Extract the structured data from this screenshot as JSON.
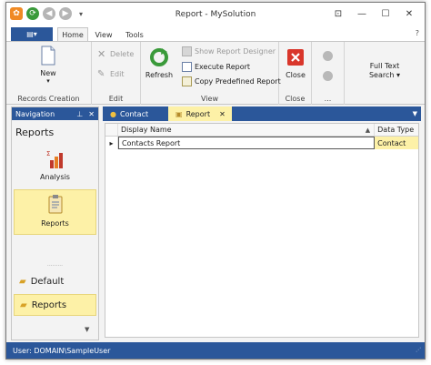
{
  "window": {
    "title": "Report - MySolution",
    "controls": {
      "help": "⊡",
      "minimize": "—",
      "maximize": "☐",
      "close": "✕"
    }
  },
  "qat": {
    "dropdown": "▾"
  },
  "ribbon_tabs": {
    "file_glyph": "▤▾",
    "tabs": [
      {
        "label": "Home",
        "active": true
      },
      {
        "label": "View",
        "active": false
      },
      {
        "label": "Tools",
        "active": false
      }
    ],
    "help": "?"
  },
  "ribbon": {
    "groups": {
      "records_creation": {
        "label": "Records Creation",
        "new": "New",
        "new_arrow": "▾"
      },
      "edit": {
        "label": "Edit",
        "delete": "Delete",
        "edit": "Edit"
      },
      "view": {
        "label": "View",
        "refresh": "Refresh",
        "show_report_designer": "Show Report Designer",
        "execute_report": "Execute Report",
        "copy_predefined_report": "Copy Predefined Report"
      },
      "close": {
        "label": "Close",
        "close": "Close"
      },
      "more": {
        "label": "..."
      },
      "search": {
        "line1": "Full Text",
        "line2": "Search ▾"
      }
    }
  },
  "navigation": {
    "header": "Navigation",
    "pin": "⊥",
    "close": "✕",
    "section_title": "Reports",
    "items": [
      {
        "label": "Analysis",
        "selected": false
      },
      {
        "label": "Reports",
        "selected": true
      }
    ],
    "splitter": "·········",
    "groups": [
      {
        "label": "Default",
        "selected": false
      },
      {
        "label": "Reports",
        "selected": true
      }
    ],
    "dropdown": "▼"
  },
  "doc_tabs": {
    "tabs": [
      {
        "label": "Contact",
        "active": false
      },
      {
        "label": "Report",
        "active": true,
        "close": "✕"
      }
    ],
    "menu": "▼"
  },
  "grid": {
    "columns": [
      "Display Name",
      "Data Type"
    ],
    "sort_indicator": "▲",
    "rows": [
      {
        "indicator": "▸",
        "display_name": "Contacts Report",
        "data_type": "Contact"
      }
    ]
  },
  "status": {
    "text": "User: DOMAIN\\SampleUser",
    "grip": "⋰"
  },
  "colors": {
    "accent": "#2b579a",
    "highlight": "#fdf1a7",
    "close_red": "#d9362b",
    "refresh_green": "#3a9a3a"
  }
}
